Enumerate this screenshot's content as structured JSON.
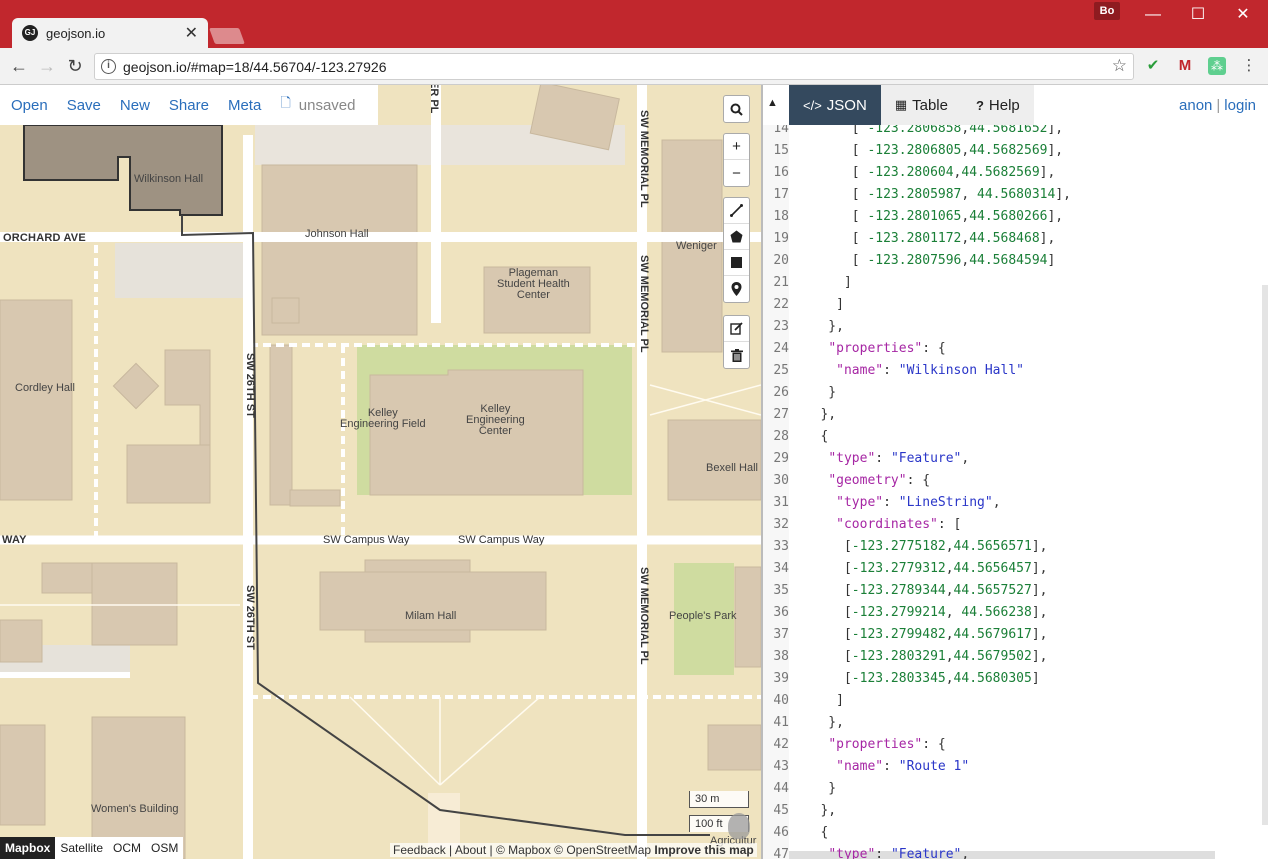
{
  "browser": {
    "tab_title": "geojson.io",
    "favicon_text": "GJ",
    "url": "geojson.io/#map=18/44.56704/-123.27926",
    "profile_name": "Bo",
    "icons": [
      "back-icon",
      "forward-icon",
      "reload-icon",
      "info-icon",
      "star-icon",
      "check-icon",
      "gmail-icon",
      "extension-icon",
      "menu-icon"
    ]
  },
  "menu": {
    "items": [
      "Open",
      "Save",
      "New",
      "Share",
      "Meta"
    ],
    "status": "unsaved"
  },
  "map": {
    "building_labels": {
      "wilkinson": "Wilkinson Hall",
      "johnson": "Johnson Hall",
      "plageman": "Plageman\nStudent Health\nCenter",
      "weniger": "Weniger",
      "cordley": "Cordley Hall",
      "kelley_field": "Kelley\nEngineering Field",
      "kelley_center": "Kelley\nEngineering\nCenter",
      "bexell": "Bexell Hall",
      "milam": "Milam Hall",
      "peoples_park": "People's Park",
      "womens": "Women's Building",
      "agriculture": "Agricultur"
    },
    "street_labels": {
      "orchard": "ORCHARD AVE",
      "way": "WAY",
      "campus_way_1": "SW Campus Way",
      "campus_way_2": "SW Campus Way",
      "sw26_top": "SW 26TH ST",
      "sw26_bottom": "SW 26TH ST",
      "memorial_top": "SW MEMORIAL PL",
      "memorial_mid": "SW MEMORIAL PL",
      "memorial_bottom": "SW MEMORIAL PL",
      "er_pl": "ER PL"
    },
    "scale": {
      "metric": "30 m",
      "imperial": "100 ft"
    },
    "basemaps": [
      "Mapbox",
      "Satellite",
      "OCM",
      "OSM"
    ],
    "active_basemap": "Mapbox",
    "attribution": {
      "text": "Feedback | About | © Mapbox © OpenStreetMap",
      "improve": "Improve this map"
    },
    "colors": {
      "land": "#efe3bf",
      "building": "#d8c8b0",
      "green": "#cfdca0",
      "road": "#ffffff",
      "route": "#444444",
      "accent": "#2a6ebb"
    }
  },
  "pane": {
    "tabs": [
      {
        "label": "JSON",
        "icon": "code-icon"
      },
      {
        "label": "Table",
        "icon": "table-icon"
      },
      {
        "label": "Help",
        "icon": "question-icon"
      }
    ],
    "active_tab": "JSON",
    "auth": {
      "anon": "anon",
      "login": "login",
      "separator": "|"
    }
  },
  "editor": {
    "lines": [
      {
        "no": "14",
        "text": "      [ -123.2806858,44.5681652],"
      },
      {
        "no": "15",
        "text": "      [ -123.2806805,44.5682569],"
      },
      {
        "no": "16",
        "text": "      [ -123.280604,44.5682569],"
      },
      {
        "no": "17",
        "text": "      [ -123.2805987, 44.5680314],"
      },
      {
        "no": "18",
        "text": "      [ -123.2801065,44.5680266],"
      },
      {
        "no": "19",
        "text": "      [ -123.2801172,44.568468],"
      },
      {
        "no": "20",
        "text": "      [ -123.2807596,44.5684594]"
      },
      {
        "no": "21",
        "text": "     ]"
      },
      {
        "no": "22",
        "text": "    ]"
      },
      {
        "no": "23",
        "text": "   },"
      },
      {
        "no": "24",
        "text": "   \"properties\": {"
      },
      {
        "no": "25",
        "text": "    \"name\": \"Wilkinson Hall\""
      },
      {
        "no": "26",
        "text": "   }"
      },
      {
        "no": "27",
        "text": "  },"
      },
      {
        "no": "28",
        "text": "  {"
      },
      {
        "no": "29",
        "text": "   \"type\": \"Feature\","
      },
      {
        "no": "30",
        "text": "   \"geometry\": {"
      },
      {
        "no": "31",
        "text": "    \"type\": \"LineString\","
      },
      {
        "no": "32",
        "text": "    \"coordinates\": ["
      },
      {
        "no": "33",
        "text": "     [-123.2775182,44.5656571],"
      },
      {
        "no": "34",
        "text": "     [-123.2779312,44.5656457],"
      },
      {
        "no": "35",
        "text": "     [-123.2789344,44.5657527],"
      },
      {
        "no": "36",
        "text": "     [-123.2799214, 44.566238],"
      },
      {
        "no": "37",
        "text": "     [-123.2799482,44.5679617],"
      },
      {
        "no": "38",
        "text": "     [-123.2803291,44.5679502],"
      },
      {
        "no": "39",
        "text": "     [-123.2803345,44.5680305]"
      },
      {
        "no": "40",
        "text": "    ]"
      },
      {
        "no": "41",
        "text": "   },"
      },
      {
        "no": "42",
        "text": "   \"properties\": {"
      },
      {
        "no": "43",
        "text": "    \"name\": \"Route 1\""
      },
      {
        "no": "44",
        "text": "   }"
      },
      {
        "no": "45",
        "text": "  },"
      },
      {
        "no": "46",
        "text": "  {"
      },
      {
        "no": "47",
        "text": "   \"type\": \"Feature\","
      }
    ]
  }
}
